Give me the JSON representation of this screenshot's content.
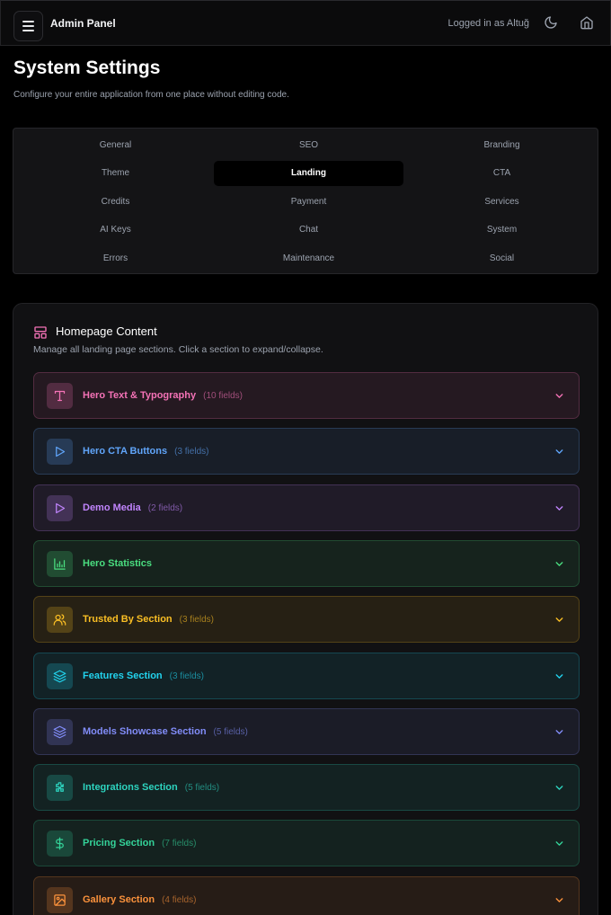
{
  "header": {
    "menu_icon": "hamburger-icon",
    "title": "Admin Panel",
    "user_status": "Logged in as Altuğ",
    "theme_icon": "moon-icon",
    "home_icon": "home-icon"
  },
  "page": {
    "title": "System Settings",
    "subtitle": "Configure your entire application from one place without editing code."
  },
  "tabs": {
    "items": [
      "General",
      "SEO",
      "Branding",
      "Theme",
      "Landing",
      "CTA",
      "Credits",
      "Payment",
      "Services",
      "AI Keys",
      "Chat",
      "System",
      "Errors",
      "Maintenance",
      "Social"
    ],
    "active": "Landing"
  },
  "homepage_content": {
    "icon": "layout-icon",
    "title": "Homepage Content",
    "subtitle": "Manage all landing page sections. Click a section to expand/collapse.",
    "sections": [
      {
        "label": "Hero Text & Typography",
        "count": "(10 fields)",
        "icon": "type-icon",
        "color": "#f472b6"
      },
      {
        "label": "Hero CTA Buttons",
        "count": "(3 fields)",
        "icon": "play-icon",
        "color": "#60a5fa"
      },
      {
        "label": "Demo Media",
        "count": "(2 fields)",
        "icon": "play-icon",
        "color": "#c084fc"
      },
      {
        "label": "Hero Statistics",
        "count": "",
        "icon": "bar-chart-icon",
        "color": "#4ade80"
      },
      {
        "label": "Trusted By Section",
        "count": "(3 fields)",
        "icon": "users-icon",
        "color": "#fbbf24"
      },
      {
        "label": "Features Section",
        "count": "(3 fields)",
        "icon": "layers-icon",
        "color": "#22d3ee"
      },
      {
        "label": "Models Showcase Section",
        "count": "(5 fields)",
        "icon": "layers-icon",
        "color": "#818cf8"
      },
      {
        "label": "Integrations Section",
        "count": "(5 fields)",
        "icon": "puzzle-icon",
        "color": "#2dd4bf"
      },
      {
        "label": "Pricing Section",
        "count": "(7 fields)",
        "icon": "dollar-icon",
        "color": "#34d399"
      },
      {
        "label": "Gallery Section",
        "count": "(4 fields)",
        "icon": "image-icon",
        "color": "#fb923c"
      }
    ]
  }
}
